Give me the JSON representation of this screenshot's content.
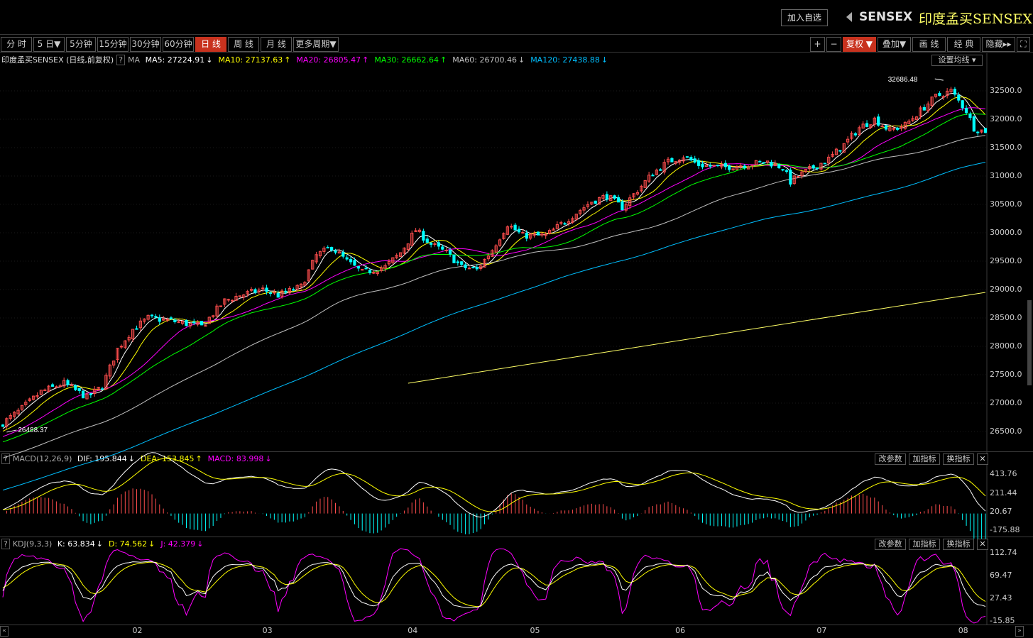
{
  "header": {
    "add_button": "加入自选",
    "index_code": "SENSEX",
    "index_name": "印度孟买SENSEX",
    "back_icon": "triangle-left-icon"
  },
  "toolbar": {
    "periods": [
      "分 时",
      "5 日▼",
      "5分钟",
      "15分钟",
      "30分钟",
      "60分钟",
      "日 线",
      "周 线",
      "月 线",
      "更多周期▼"
    ],
    "active_period": "日 线",
    "right_buttons": [
      "+",
      "−",
      "复权 ▼",
      "叠加▼",
      "画 线",
      "经 典",
      "隐藏▸▸",
      "⛶"
    ],
    "active_right": "复权 ▼"
  },
  "main_legend": {
    "title": "印度孟买SENSEX (日线,前复权)",
    "help": "?",
    "ma_label": "MA",
    "items": [
      {
        "text": "MA5: 27224.91",
        "arrow": "↓",
        "color": "#ffffff"
      },
      {
        "text": "MA10: 27137.63",
        "arrow": "↑",
        "color": "#ffff00"
      },
      {
        "text": "MA20: 26805.47",
        "arrow": "↑",
        "color": "#ff00ff"
      },
      {
        "text": "MA30: 26662.64",
        "arrow": "↑",
        "color": "#00ff00"
      },
      {
        "text": "MA60: 26700.46",
        "arrow": "↓",
        "color": "#c0c0c0"
      },
      {
        "text": "MA120: 27438.88",
        "arrow": "↓",
        "color": "#00bfff"
      }
    ],
    "settings_button": "设置均线 ▾"
  },
  "macd_legend": {
    "help": "?",
    "title": "MACD(12,26,9)",
    "items": [
      {
        "text": "DIF: 195.844",
        "arrow": "↓",
        "color": "#ffffff"
      },
      {
        "text": "DEA: 153.845",
        "arrow": "↑",
        "color": "#ffff00"
      },
      {
        "text": "MACD: 83.998",
        "arrow": "↓",
        "color": "#ff00ff"
      }
    ]
  },
  "kdj_legend": {
    "help": "?",
    "title": "KDJ(9,3,3)",
    "items": [
      {
        "text": "K: 63.834",
        "arrow": "↓",
        "color": "#ffffff"
      },
      {
        "text": "D: 74.562",
        "arrow": "↓",
        "color": "#ffff00"
      },
      {
        "text": "J: 42.379",
        "arrow": "↓",
        "color": "#ff00ff"
      }
    ]
  },
  "panel_buttons": [
    "改参数",
    "加指标",
    "换指标",
    "✕"
  ],
  "chart_data": {
    "type": "candlestick",
    "price_axis_labels": [
      "32500.0",
      "32000.0",
      "31500.0",
      "31000.0",
      "30500.0",
      "30000.0",
      "29500.0",
      "29000.0",
      "28500.0",
      "28000.0",
      "27500.0",
      "27000.0",
      "26500.0"
    ],
    "price_range": [
      26200,
      32900
    ],
    "macd_axis_labels": [
      "413.76",
      "211.44",
      "20.67",
      "-175.88"
    ],
    "macd_range": [
      -210,
      470
    ],
    "kdj_axis_labels": [
      "112.74",
      "69.47",
      "27.43",
      "-15.85"
    ],
    "kdj_range": [
      -20,
      125
    ],
    "x_labels": [
      {
        "label": "02",
        "index": 35
      },
      {
        "label": "03",
        "index": 69
      },
      {
        "label": "04",
        "index": 107
      },
      {
        "label": "05",
        "index": 139
      },
      {
        "label": "06",
        "index": 177
      },
      {
        "label": "07",
        "index": 214
      },
      {
        "label": "08",
        "index": 251
      }
    ],
    "annotations": [
      {
        "text": "26488.37",
        "index": 1,
        "value": 26488.37,
        "kind": "low"
      },
      {
        "text": "32686.48",
        "index": 246,
        "value": 32686.48,
        "kind": "high"
      }
    ],
    "close_anchors": [
      [
        0,
        26650
      ],
      [
        4,
        26850
      ],
      [
        10,
        27200
      ],
      [
        16,
        27350
      ],
      [
        22,
        27100
      ],
      [
        26,
        27300
      ],
      [
        30,
        27950
      ],
      [
        34,
        28300
      ],
      [
        38,
        28500
      ],
      [
        44,
        28450
      ],
      [
        52,
        28350
      ],
      [
        58,
        28800
      ],
      [
        62,
        28900
      ],
      [
        68,
        29000
      ],
      [
        72,
        28900
      ],
      [
        78,
        29050
      ],
      [
        82,
        29600
      ],
      [
        86,
        29750
      ],
      [
        90,
        29500
      ],
      [
        94,
        29300
      ],
      [
        100,
        29400
      ],
      [
        104,
        29650
      ],
      [
        108,
        30050
      ],
      [
        112,
        29800
      ],
      [
        116,
        29650
      ],
      [
        120,
        29400
      ],
      [
        124,
        29350
      ],
      [
        128,
        29700
      ],
      [
        132,
        30150
      ],
      [
        136,
        29950
      ],
      [
        142,
        29950
      ],
      [
        148,
        30250
      ],
      [
        154,
        30550
      ],
      [
        158,
        30650
      ],
      [
        162,
        30450
      ],
      [
        166,
        30750
      ],
      [
        170,
        31050
      ],
      [
        174,
        31250
      ],
      [
        178,
        31350
      ],
      [
        182,
        31200
      ],
      [
        188,
        31150
      ],
      [
        194,
        31200
      ],
      [
        200,
        31250
      ],
      [
        204,
        31150
      ],
      [
        206,
        30900
      ],
      [
        208,
        31000
      ],
      [
        212,
        31150
      ],
      [
        216,
        31300
      ],
      [
        220,
        31550
      ],
      [
        224,
        31850
      ],
      [
        228,
        32000
      ],
      [
        232,
        31800
      ],
      [
        236,
        31900
      ],
      [
        240,
        32150
      ],
      [
        244,
        32400
      ],
      [
        248,
        32500
      ],
      [
        252,
        32150
      ],
      [
        254,
        31850
      ],
      [
        256,
        31800
      ]
    ],
    "n_candles": 258,
    "long_ma_line": {
      "color": "#ffff66",
      "start_index": 106,
      "start_value": 27350,
      "end_index": 258,
      "end_value": 28950
    },
    "moving_averages": [
      {
        "name": "MA5",
        "period": 5,
        "color": "#ffffff"
      },
      {
        "name": "MA10",
        "period": 10,
        "color": "#ffff00"
      },
      {
        "name": "MA20",
        "period": 20,
        "color": "#ff00ff"
      },
      {
        "name": "MA30",
        "period": 30,
        "color": "#00ff00"
      },
      {
        "name": "MA60",
        "period": 60,
        "color": "#c0c0c0"
      },
      {
        "name": "MA120",
        "period": 120,
        "color": "#00bfff"
      }
    ],
    "colors": {
      "up": "#ff4d4d",
      "down": "#00ffff",
      "grid": "#3a3a3a"
    }
  }
}
